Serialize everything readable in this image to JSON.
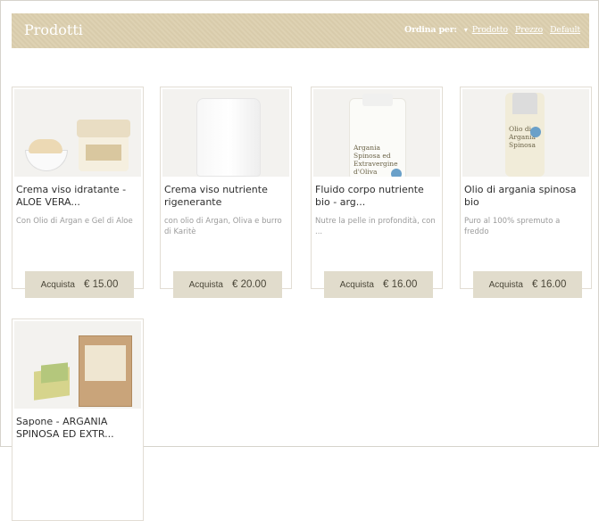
{
  "header": {
    "title": "Prodotti",
    "sort_label": "Ordina per:",
    "sort_options": [
      "Prodotto",
      "Prezzo",
      "Default"
    ]
  },
  "products": [
    {
      "name": "Crema viso idratante - ALOE VERA...",
      "description": "Con Olio di Argan e Gel di Aloe",
      "buy_label": "Acquista",
      "price": "€ 15.00",
      "image_icon": "cream-jar-image"
    },
    {
      "name": "Crema viso nutriente rigenerante",
      "description": "con olio di Argan, Oliva e burro di Karitè",
      "buy_label": "Acquista",
      "price": "€ 20.00",
      "image_icon": "pump-bottle-image"
    },
    {
      "name": "Fluido corpo nutriente bio - arg...",
      "description": "Nutre la pelle in profondità, con ...",
      "buy_label": "Acquista",
      "price": "€ 16.00",
      "image_icon": "bottle-image",
      "image_label": "Argania Spinosa ed Extravergine d'Oliva"
    },
    {
      "name": "Olio di argania spinosa bio",
      "description": "Puro al 100% spremuto a freddo",
      "buy_label": "Acquista",
      "price": "€ 16.00",
      "image_icon": "oil-vial-image",
      "image_label": "Olio di Argania Spinosa"
    },
    {
      "name": "Sapone - ARGANIA SPINOSA ED EXTR...",
      "description": "",
      "buy_label": "",
      "price": "",
      "image_icon": "soap-bar-image"
    }
  ],
  "colors": {
    "header_bg": "#dccfae",
    "button_bg": "#e1dccc"
  }
}
